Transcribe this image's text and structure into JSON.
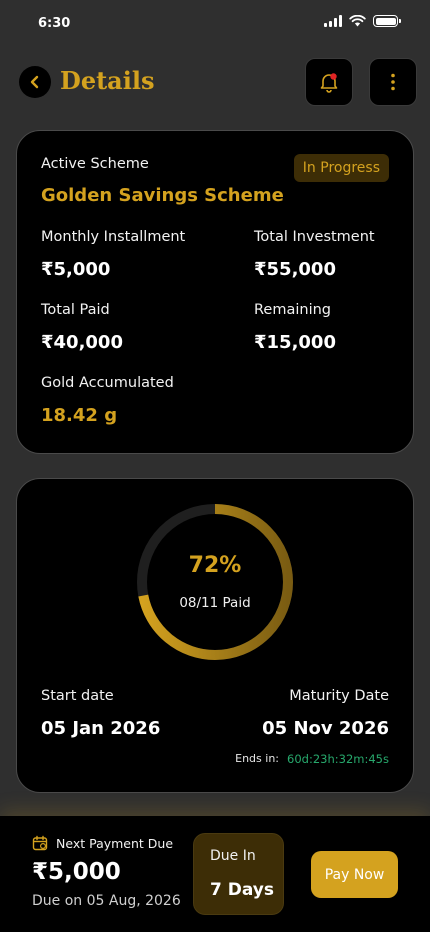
{
  "status_bar": {
    "time": "6:30"
  },
  "header": {
    "title": "Details"
  },
  "scheme": {
    "active_label": "Active Scheme",
    "name": "Golden Savings Scheme",
    "status": "In Progress",
    "monthly_label": "Monthly Installment",
    "monthly_value": "₹5,000",
    "total_investment_label": "Total Investment",
    "total_investment_value": "₹55,000",
    "total_paid_label": "Total Paid",
    "total_paid_value": "₹40,000",
    "remaining_label": "Remaining",
    "remaining_value": "₹15,000",
    "gold_label": "Gold Accumulated",
    "gold_value": "18.42 g"
  },
  "progress": {
    "percent_text": "72%",
    "fraction": 0.72,
    "paid_text": "08/11 Paid",
    "start_label": "Start date",
    "start_value": "05 Jan 2026",
    "maturity_label": "Maturity Date",
    "maturity_value": "05 Nov 2026",
    "ends_label": "Ends in:",
    "ends_value": "60d:23h:32m:45s"
  },
  "bottom": {
    "next_label": "Next Payment Due",
    "amount": "₹5,000",
    "due_date": "Due on 05 Aug, 2026",
    "due_in_label": "Due In",
    "due_in_value": "7 Days",
    "pay_label": "Pay Now"
  },
  "colors": {
    "accent": "#d4a21f",
    "badge_bg": "#3d2d06",
    "countdown": "#27a86c",
    "background": "#2f2f2f",
    "card": "#000000"
  },
  "icons": {
    "back": "chevron-left-icon",
    "bell": "bell-icon",
    "more": "more-vertical-icon",
    "calendar": "calendar-icon"
  }
}
